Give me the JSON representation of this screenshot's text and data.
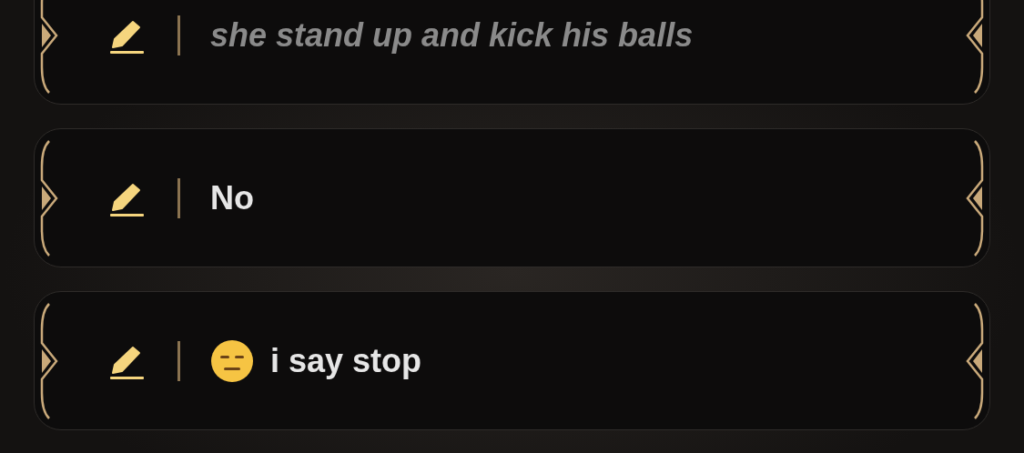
{
  "options": [
    {
      "text": "she stand up and kick his balls",
      "kind": "narration",
      "emoji": false
    },
    {
      "text": "No",
      "kind": "speech",
      "emoji": false
    },
    {
      "text": "i say stop",
      "kind": "speech",
      "emoji": true
    }
  ]
}
